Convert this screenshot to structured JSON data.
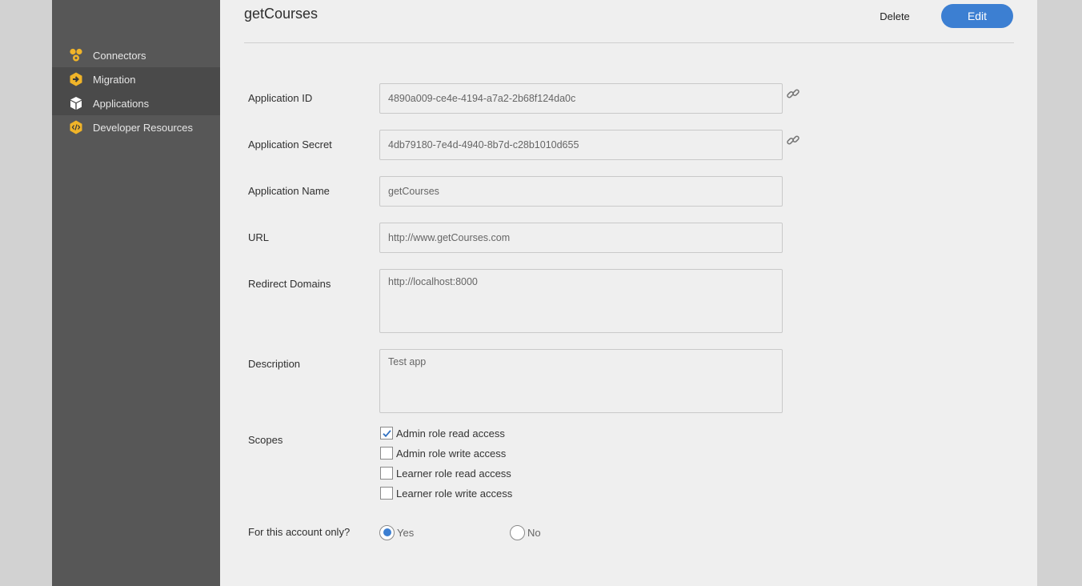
{
  "sidebar": {
    "items": [
      {
        "label": "Connectors",
        "icon": "connectors-icon"
      },
      {
        "label": "Migration",
        "icon": "migration-icon"
      },
      {
        "label": "Applications",
        "icon": "applications-icon"
      },
      {
        "label": "Developer Resources",
        "icon": "developer-resources-icon"
      }
    ]
  },
  "header": {
    "title": "getCourses",
    "delete_label": "Delete",
    "edit_label": "Edit"
  },
  "form": {
    "app_id": {
      "label": "Application ID",
      "value": "4890a009-ce4e-4194-a7a2-2b68f124da0c"
    },
    "app_secret": {
      "label": "Application Secret",
      "value": "4db79180-7e4d-4940-8b7d-c28b1010d655"
    },
    "app_name": {
      "label": "Application Name",
      "value": "getCourses"
    },
    "url": {
      "label": "URL",
      "value": "http://www.getCourses.com"
    },
    "redirect": {
      "label": "Redirect Domains",
      "value": "http://localhost:8000"
    },
    "description": {
      "label": "Description",
      "value": "Test app"
    },
    "scopes": {
      "label": "Scopes",
      "options": [
        {
          "label": "Admin role read access",
          "checked": true
        },
        {
          "label": "Admin role write access",
          "checked": false
        },
        {
          "label": "Learner role read access",
          "checked": false
        },
        {
          "label": "Learner role write access",
          "checked": false
        }
      ]
    },
    "account_only": {
      "label": "For this account only?",
      "yes_label": "Yes",
      "no_label": "No",
      "selected": "Yes"
    }
  },
  "colors": {
    "accent": "#3c7fd2",
    "sidebar_bg": "#575757",
    "icon_yellow": "#f0b429"
  }
}
